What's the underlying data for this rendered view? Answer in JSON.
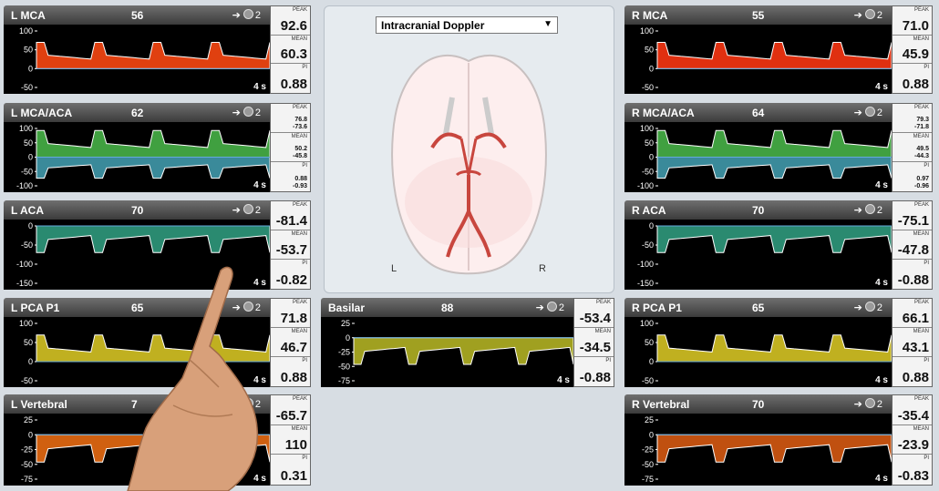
{
  "panels": [
    {
      "id": "l-mca",
      "name": "L MCA",
      "depth": "56",
      "ax": "100|50|0|-50",
      "time": "4 s",
      "peak": "92.6",
      "mean": "60.3",
      "pi": "0.88",
      "col": "#e04010"
    },
    {
      "id": "l-mca-aca",
      "name": "L MCA/ACA",
      "depth": "62",
      "ax": "100|50|0|-50|-100",
      "time": "4 s",
      "peak": "76.8\n-73.6",
      "mean": "50.2\n-45.8",
      "pi": "0.88\n-0.93",
      "col": "#40a040",
      "small": true
    },
    {
      "id": "l-aca",
      "name": "L ACA",
      "depth": "70",
      "ax": "0|-50|-100|-150",
      "time": "4 s",
      "peak": "-81.4",
      "mean": "-53.7",
      "pi": "-0.82",
      "col": "#2a8a70"
    },
    {
      "id": "l-pca",
      "name": "L PCA P1",
      "depth": "65",
      "ax": "100|50|0|-50",
      "time": "4 s",
      "peak": "71.8",
      "mean": "46.7",
      "pi": "0.88",
      "col": "#c0b020"
    },
    {
      "id": "l-vert",
      "name": "L Vertebral",
      "depth": "7",
      "ax": "25|0|-25|-50|-75",
      "time": "4 s",
      "peak": "-65.7",
      "mean": "110",
      "pi": "0.31",
      "col": "#d06010"
    },
    {
      "id": "basilar",
      "name": "Basilar",
      "depth": "88",
      "ax": "25|0|-25|-50|-75",
      "time": "4 s",
      "peak": "-53.4",
      "mean": "-34.5",
      "pi": "-0.88",
      "col": "#a0a020"
    },
    {
      "id": "r-mca",
      "name": "R MCA",
      "depth": "55",
      "ax": "100|50|0|-50",
      "time": "4 s",
      "peak": "71.0",
      "mean": "45.9",
      "pi": "0.88",
      "col": "#e03010"
    },
    {
      "id": "r-mca-aca",
      "name": "R MCA/ACA",
      "depth": "64",
      "ax": "100|50|0|-50|-100",
      "time": "4 s",
      "peak": "79.3\n-71.8",
      "mean": "49.5\n-44.3",
      "pi": "0.97\n-0.96",
      "col": "#40a040",
      "small": true
    },
    {
      "id": "r-aca",
      "name": "R ACA",
      "depth": "70",
      "ax": "0|-50|-100|-150",
      "time": "4 s",
      "peak": "-75.1",
      "mean": "-47.8",
      "pi": "-0.88",
      "col": "#2a8a70"
    },
    {
      "id": "r-pca",
      "name": "R PCA P1",
      "depth": "65",
      "ax": "100|50|0|-50",
      "time": "4 s",
      "peak": "66.1",
      "mean": "43.1",
      "pi": "0.88",
      "col": "#c0b020"
    },
    {
      "id": "r-vert",
      "name": "R Vertebral",
      "depth": "70",
      "ax": "25|0|-25|-50|-75",
      "time": "4 s",
      "peak": "-35.4",
      "mean": "-23.9",
      "pi": "-0.83",
      "col": "#c05010"
    }
  ],
  "labels": {
    "peak": "PEAK",
    "mean": "MEAN",
    "pi": "PI",
    "count": "2"
  },
  "center": {
    "select": "Intracranial Doppler",
    "left": "L",
    "right": "R"
  }
}
